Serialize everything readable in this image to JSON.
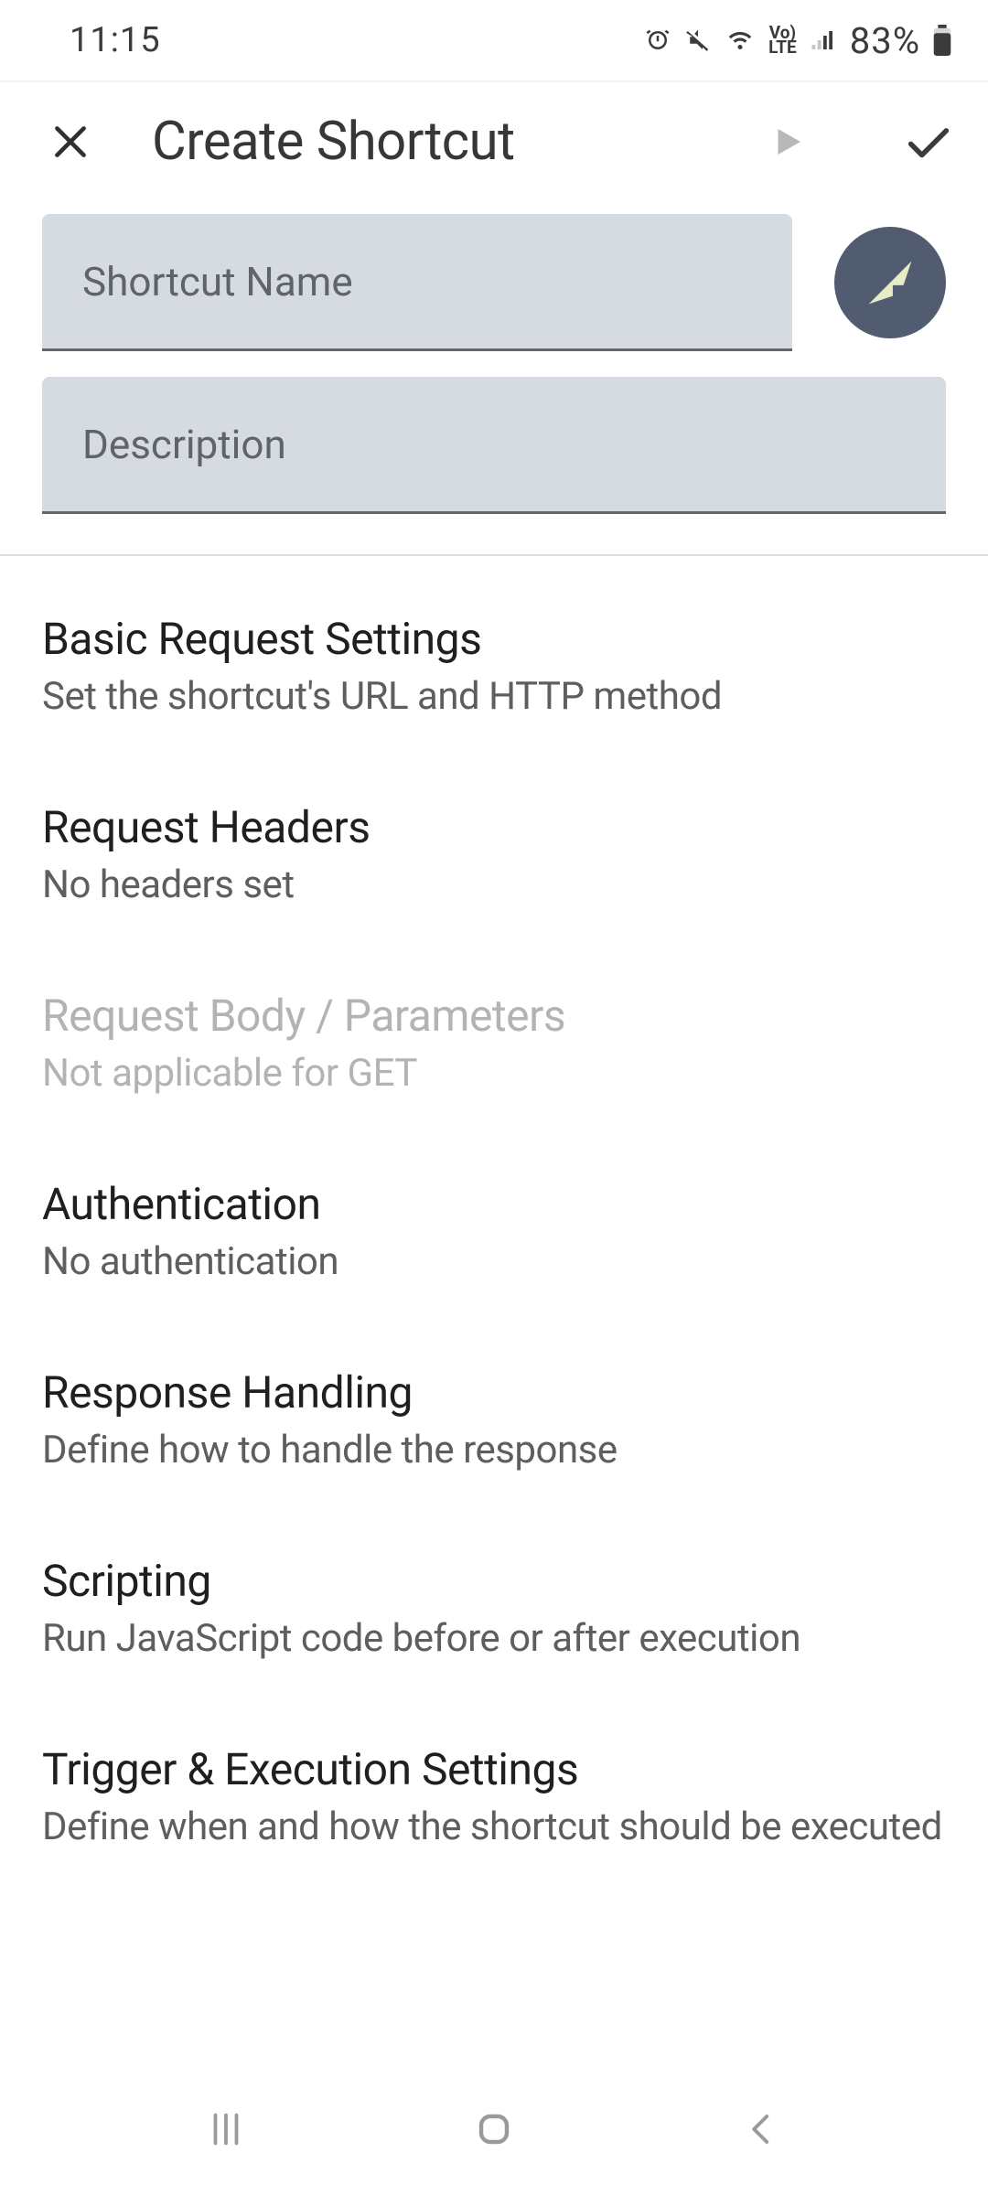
{
  "status": {
    "time": "11:15",
    "battery": "83%"
  },
  "header": {
    "title": "Create Shortcut"
  },
  "fields": {
    "name_placeholder": "Shortcut Name",
    "desc_placeholder": "Description"
  },
  "sections": [
    {
      "title": "Basic Request Settings",
      "sub": "Set the shortcut's URL and HTTP method",
      "disabled": false
    },
    {
      "title": "Request Headers",
      "sub": "No headers set",
      "disabled": false
    },
    {
      "title": "Request Body / Parameters",
      "sub": "Not applicable for GET",
      "disabled": true
    },
    {
      "title": "Authentication",
      "sub": "No authentication",
      "disabled": false
    },
    {
      "title": "Response Handling",
      "sub": "Define how to handle the response",
      "disabled": false
    },
    {
      "title": "Scripting",
      "sub": "Run JavaScript code before or after execution",
      "disabled": false
    },
    {
      "title": "Trigger & Execution Settings",
      "sub": "Define when and how the shortcut should be executed",
      "disabled": false
    }
  ]
}
